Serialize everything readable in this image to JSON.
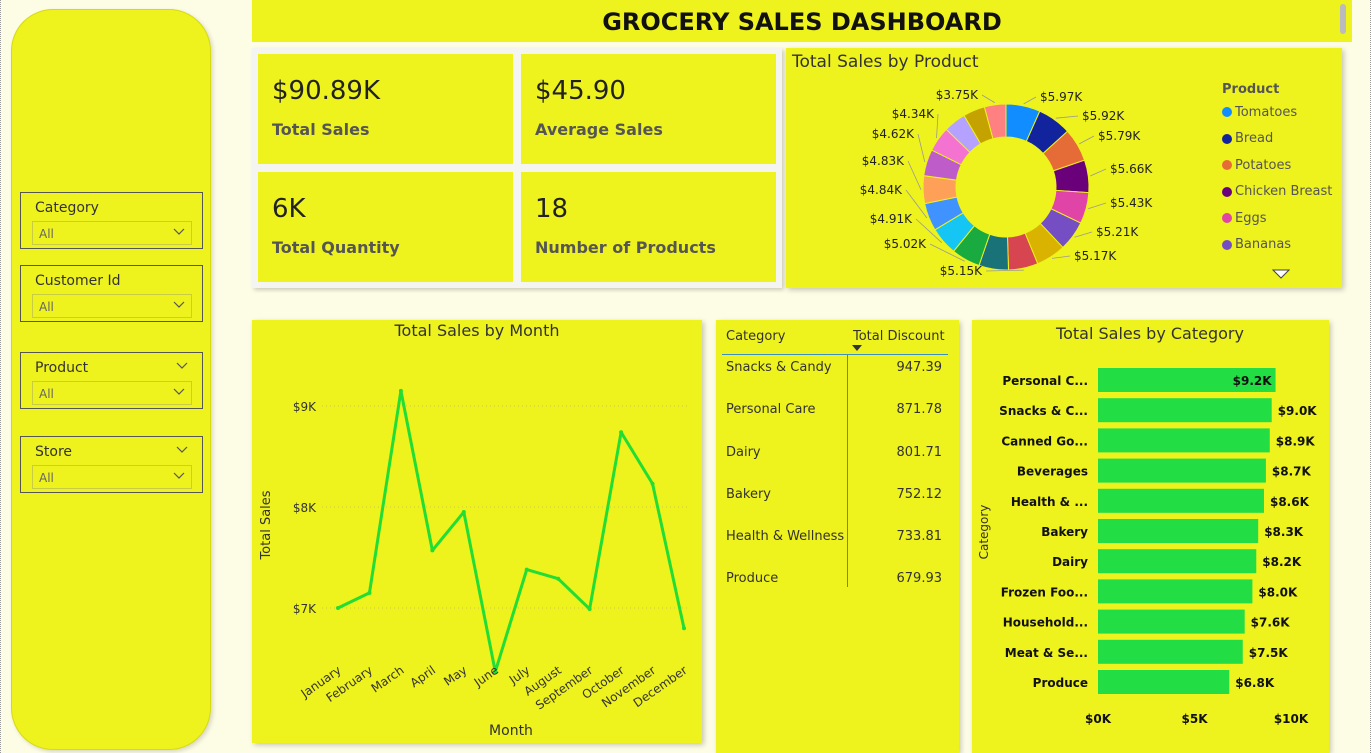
{
  "dashboard": {
    "title": "GROCERY SALES DASHBOARD"
  },
  "slicers": [
    {
      "title": "Category",
      "value": "All"
    },
    {
      "title": "Customer Id",
      "value": "All"
    },
    {
      "title": "Product",
      "value": "All"
    },
    {
      "title": "Store",
      "value": "All"
    }
  ],
  "kpis": [
    {
      "value": "$90.89K",
      "label": "Total Sales"
    },
    {
      "value": "$45.90",
      "label": "Average Sales"
    },
    {
      "value": "6K",
      "label": "Total Quantity"
    },
    {
      "value": "18",
      "label": "Number of Products"
    }
  ],
  "donut": {
    "title": "Total Sales by Product",
    "legend_title": "Product",
    "legend": [
      {
        "name": "Tomatoes",
        "color": "#118dff"
      },
      {
        "name": "Bread",
        "color": "#12239e"
      },
      {
        "name": "Potatoes",
        "color": "#e66c37"
      },
      {
        "name": "Chicken Breast",
        "color": "#6b007b"
      },
      {
        "name": "Eggs",
        "color": "#e044a7"
      },
      {
        "name": "Bananas",
        "color": "#744ec2"
      }
    ]
  },
  "table": {
    "headers": [
      "Category",
      "Total Discount"
    ],
    "rows": [
      {
        "category": "Snacks & Candy",
        "discount": "947.39"
      },
      {
        "category": "Personal Care",
        "discount": "871.78"
      },
      {
        "category": "Dairy",
        "discount": "801.71"
      },
      {
        "category": "Bakery",
        "discount": "752.12"
      },
      {
        "category": "Health & Wellness",
        "discount": "733.81"
      },
      {
        "category": "Produce",
        "discount": "679.93"
      }
    ]
  },
  "chart_data": [
    {
      "type": "pie",
      "title": "Total Sales by Product",
      "legend_title": "Product",
      "legend_position": "right",
      "labels_shown": [
        "$5.97K",
        "$5.92K",
        "$5.79K",
        "$5.66K",
        "$5.43K",
        "$5.21K",
        "$5.17K",
        "$5.15K",
        "$5.02K",
        "$4.91K",
        "$4.84K",
        "$4.83K",
        "$4.62K",
        "$4.34K",
        "$3.75K"
      ],
      "values": [
        5.97,
        5.92,
        5.79,
        5.66,
        5.43,
        5.21,
        5.17,
        5.15,
        5.15,
        5.02,
        4.91,
        4.84,
        4.83,
        4.62,
        4.34,
        3.9,
        3.8,
        3.75
      ],
      "colors": [
        "#118dff",
        "#12239e",
        "#e66c37",
        "#6b007b",
        "#e044a7",
        "#744ec2",
        "#d9b300",
        "#d64550",
        "#197278",
        "#1aab40",
        "#15c6f4",
        "#4092ff",
        "#ffa058",
        "#be5dc9",
        "#f472d0",
        "#b5a1ff",
        "#c4a200",
        "#ff8080"
      ]
    },
    {
      "type": "line",
      "title": "Total Sales by Month",
      "xlabel": "Month",
      "ylabel": "Total Sales",
      "categories": [
        "January",
        "February",
        "March",
        "April",
        "May",
        "June",
        "July",
        "August",
        "September",
        "October",
        "November",
        "December"
      ],
      "values": [
        7000,
        7150,
        9150,
        7570,
        7950,
        6370,
        7380,
        7290,
        6990,
        8740,
        8230,
        6800
      ],
      "yticks": [
        "$7K",
        "$8K",
        "$9K"
      ],
      "ylim": [
        6200,
        9500
      ],
      "color": "#22dd33"
    },
    {
      "type": "bar",
      "title": "Total Sales by Category",
      "ylabel": "Category",
      "categories": [
        "Personal C...",
        "Snacks & C...",
        "Canned Go...",
        "Beverages",
        "Health & ...",
        "Bakery",
        "Dairy",
        "Frozen Foo...",
        "Household...",
        "Meat & Se...",
        "Produce"
      ],
      "values": [
        9.2,
        9.0,
        8.9,
        8.7,
        8.6,
        8.3,
        8.2,
        8.0,
        7.6,
        7.5,
        6.8
      ],
      "labels": [
        "$9.2K",
        "$9.0K",
        "$8.9K",
        "$8.7K",
        "$8.6K",
        "$8.3K",
        "$8.2K",
        "$8.0K",
        "$7.6K",
        "$7.5K",
        "$6.8K"
      ],
      "xticks": [
        "$0K",
        "$5K",
        "$10K"
      ],
      "xlim": [
        0,
        10
      ],
      "color": "#22dd44"
    }
  ]
}
